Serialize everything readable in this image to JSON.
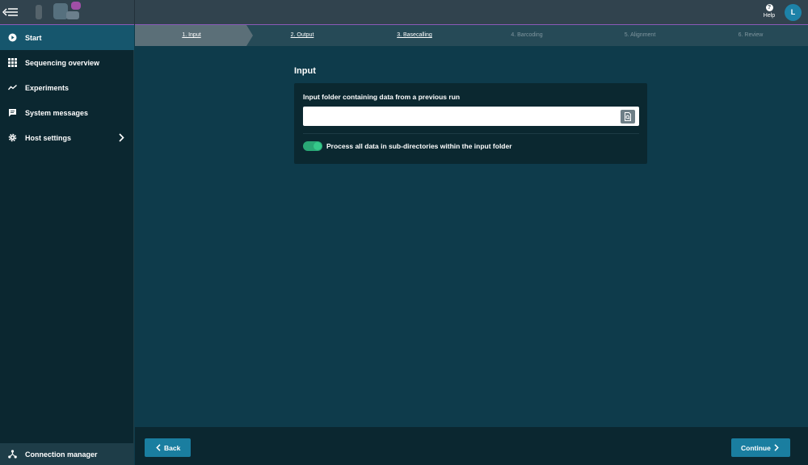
{
  "header": {
    "help_label": "Help",
    "help_glyph": "?",
    "user_initial": "L",
    "logo_icon": "blurred-logo-icon",
    "menu_icon": "menu-collapse-icon"
  },
  "sidebar": {
    "items": [
      {
        "label": "Start",
        "icon": "play-circle-icon"
      },
      {
        "label": "Sequencing overview",
        "icon": "grid-icon"
      },
      {
        "label": "Experiments",
        "icon": "trend-line-icon"
      },
      {
        "label": "System messages",
        "icon": "message-icon"
      },
      {
        "label": "Host settings",
        "icon": "gear-icon"
      }
    ],
    "connection_manager": "Connection manager"
  },
  "stepper": {
    "steps": [
      {
        "label": "1. Input",
        "state": "active"
      },
      {
        "label": "2. Output",
        "state": "done"
      },
      {
        "label": "3. Basecalling",
        "state": "done"
      },
      {
        "label": "4. Barcoding",
        "state": "pending"
      },
      {
        "label": "5. Alignment",
        "state": "pending"
      },
      {
        "label": "6. Review",
        "state": "pending"
      }
    ]
  },
  "main": {
    "title": "Input",
    "folder_label": "Input folder containing data from a previous run",
    "folder_value": "",
    "toggle_label": "Process all data in sub-directories within the input folder",
    "toggle_on": true
  },
  "footer": {
    "back_label": "Back",
    "continue_label": "Continue"
  },
  "colors": {
    "accent": "#1a7ea0",
    "toggle_on": "#2aa876",
    "active_nav": "#16566d",
    "background": "#0e3b4b"
  }
}
